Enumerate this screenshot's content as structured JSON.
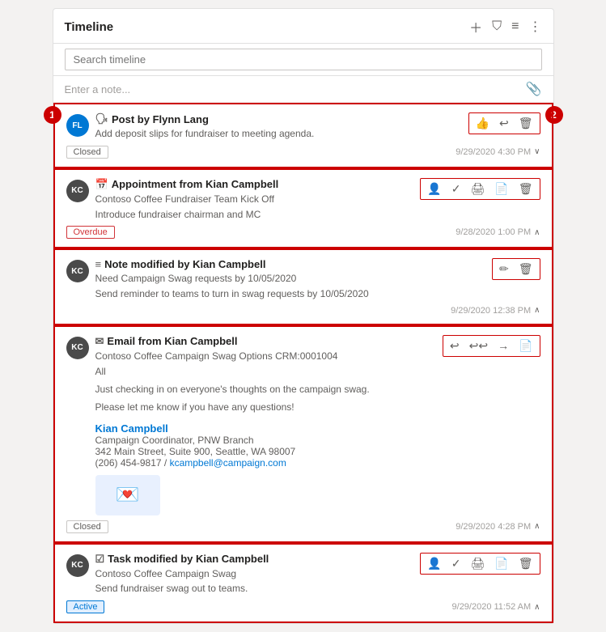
{
  "header": {
    "title": "Timeline",
    "icons": [
      "plus",
      "filter",
      "list",
      "more"
    ]
  },
  "search": {
    "placeholder": "Search timeline"
  },
  "note": {
    "placeholder": "Enter a note..."
  },
  "items": [
    {
      "id": "post",
      "type": "Post",
      "icon": "post-icon",
      "author": "Flynn Lang",
      "avatar": "FL",
      "avatar_class": "avatar-fl",
      "description": "Add deposit slips for fundraiser to meeting agenda.",
      "status": "Closed",
      "status_class": "",
      "timestamp": "9/29/2020 4:30 PM",
      "expanded": true,
      "actions": [
        "thumbup",
        "reply",
        "trash"
      ]
    },
    {
      "id": "appointment",
      "type": "Appointment",
      "icon": "appointment-icon",
      "author": "Kian Campbell",
      "avatar": "KC",
      "avatar_class": "avatar-kc",
      "description1": "Contoso Coffee Fundraiser Team Kick Off",
      "description2": "Introduce fundraiser chairman and MC",
      "status": "Overdue",
      "status_class": "status-overdue",
      "timestamp": "9/28/2020 1:00 PM",
      "expanded": true,
      "actions": [
        "assign",
        "check",
        "print",
        "doc",
        "trash"
      ]
    },
    {
      "id": "note",
      "type": "Note",
      "icon": "note-icon",
      "author": "Kian Campbell",
      "avatar": "KC",
      "avatar_class": "avatar-kc",
      "description1": "Need Campaign Swag requests by 10/05/2020",
      "description2": "Send reminder to teams to turn in swag requests by 10/05/2020",
      "status": "",
      "timestamp": "9/29/2020 12:38 PM",
      "expanded": true,
      "actions": [
        "edit",
        "trash"
      ]
    },
    {
      "id": "email",
      "type": "Email",
      "icon": "email-icon",
      "author": "Kian Campbell",
      "avatar": "KC",
      "avatar_class": "avatar-kc",
      "description1": "Contoso Coffee Campaign Swag Options CRM:0001004",
      "description2": "All",
      "body1": "Just checking in on everyone's thoughts on the campaign swag.",
      "body2": "Please let me know if you have any questions!",
      "sig_name": "Kian Campbell",
      "sig_title": "Campaign Coordinator, PNW Branch",
      "sig_address": "342 Main Street, Suite 900, Seattle, WA 98007",
      "sig_phone": "(206) 454-9817",
      "sig_email": "kcampbell@campaign.com",
      "status": "Closed",
      "status_class": "",
      "timestamp": "9/29/2020 4:28 PM",
      "expanded": true,
      "actions": [
        "reply",
        "replyall",
        "forward",
        "doc"
      ]
    },
    {
      "id": "task",
      "type": "Task",
      "icon": "task-icon",
      "author": "Kian Campbell",
      "avatar": "KC",
      "avatar_class": "avatar-kc",
      "description1": "Contoso Coffee Campaign Swag",
      "description2": "Send fundraiser swag out to teams.",
      "status": "Active",
      "status_class": "status-active",
      "timestamp": "9/29/2020 11:52 AM",
      "expanded": true,
      "actions": [
        "assign",
        "check",
        "print",
        "doc",
        "trash"
      ]
    }
  ],
  "annotations": {
    "circle1": "1",
    "circle2": "2"
  }
}
